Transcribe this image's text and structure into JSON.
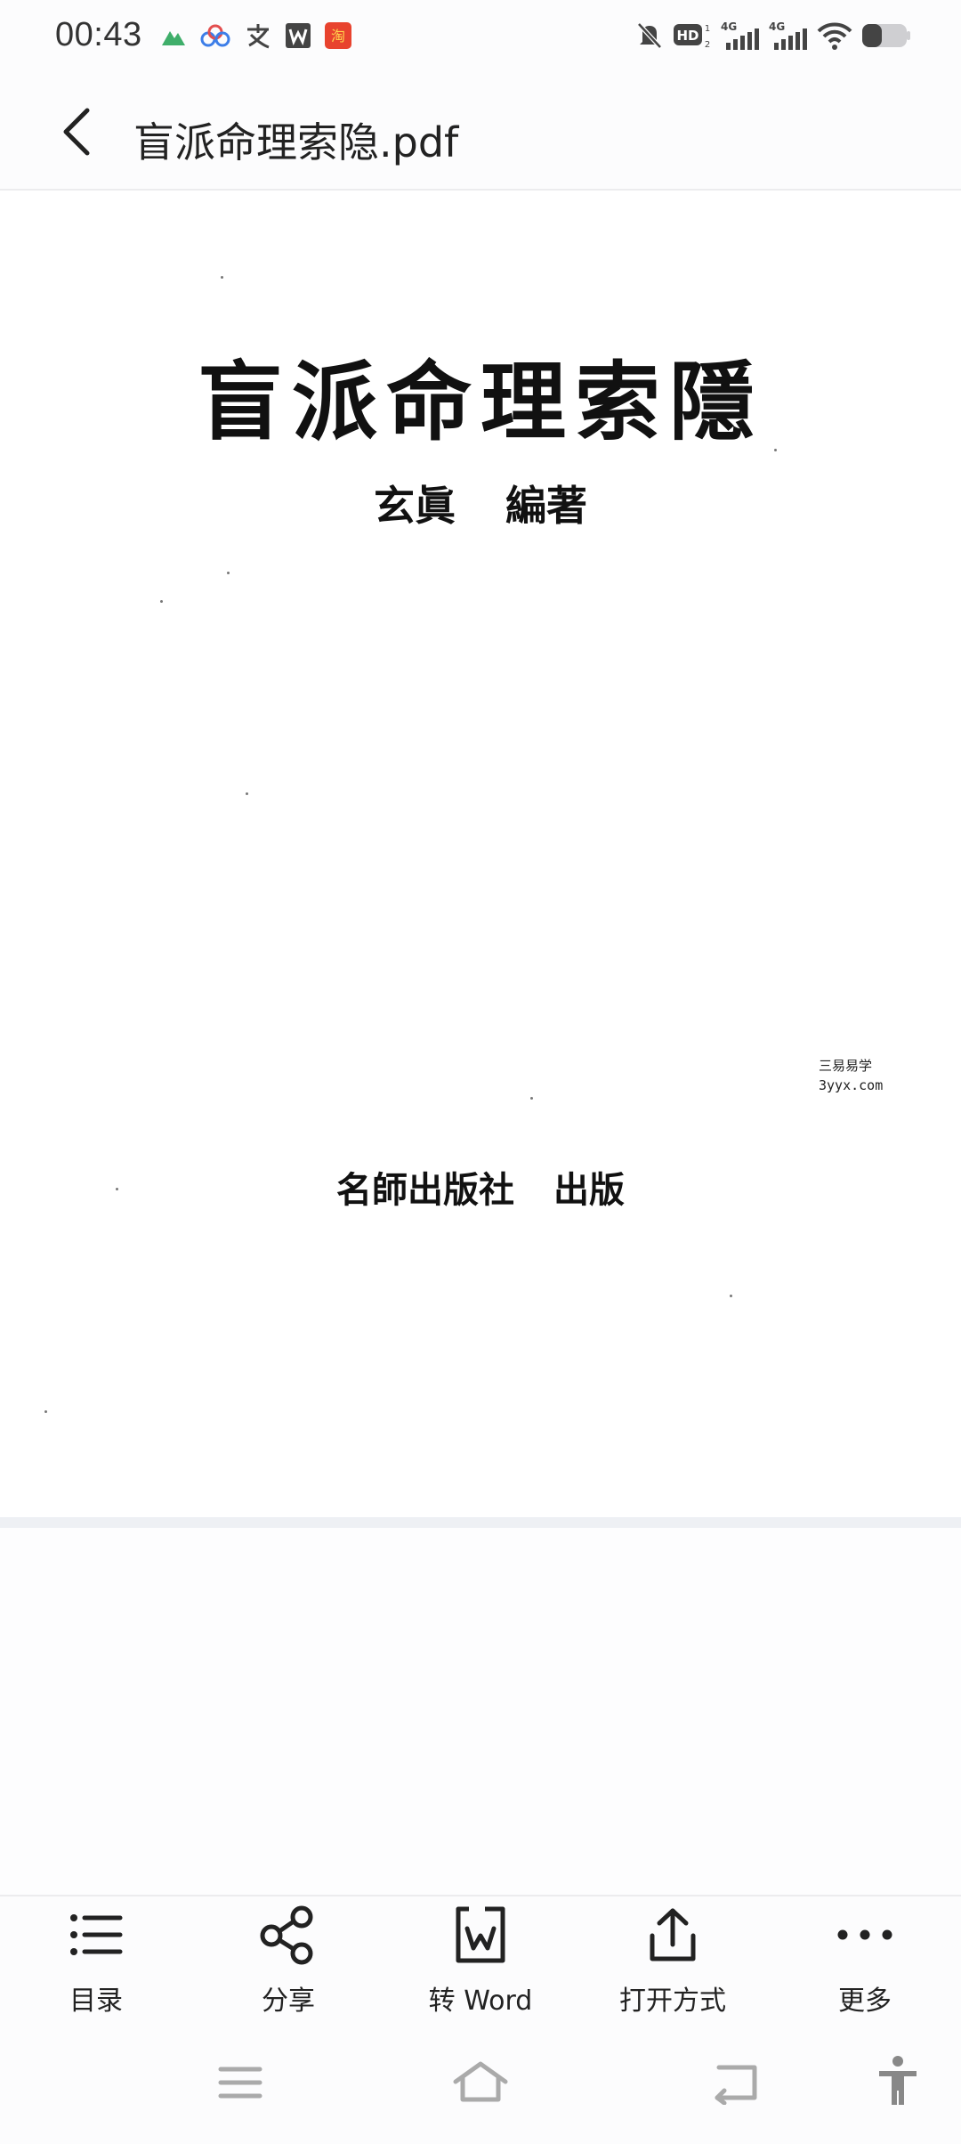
{
  "status_bar": {
    "time": "00:43"
  },
  "app_bar": {
    "title": "盲派命理索隐.pdf"
  },
  "page": {
    "title": "盲派命理索隱",
    "author": "玄眞 編著",
    "publisher": "名師出版社 出版",
    "watermark_line1": "三易易学",
    "watermark_line2": "3yyx.com"
  },
  "toolbar": {
    "items": [
      {
        "label": "目录",
        "icon": "list-icon"
      },
      {
        "label": "分享",
        "icon": "share-icon"
      },
      {
        "label": "转 Word",
        "icon": "convert-word-icon"
      },
      {
        "label": "打开方式",
        "icon": "open-with-icon"
      },
      {
        "label": "更多",
        "icon": "more-icon"
      }
    ]
  },
  "nav_bar": {
    "icons": [
      "menu-icon",
      "home-icon",
      "back-icon",
      "accessibility-icon"
    ]
  },
  "colors": {
    "background": "#fcfcfd",
    "text": "#222222",
    "divider": "#ececee"
  }
}
